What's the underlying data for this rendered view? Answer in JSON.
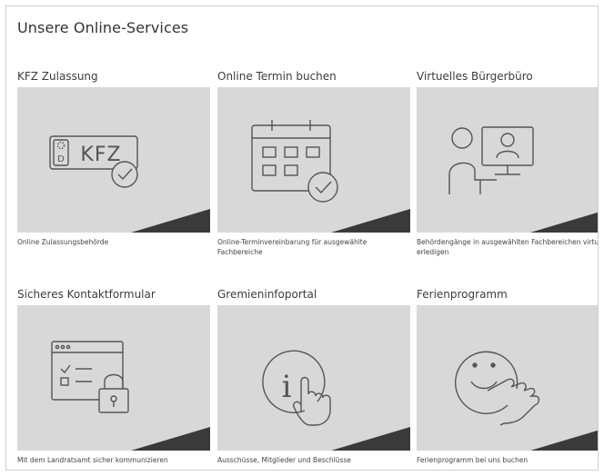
{
  "page": {
    "title": "Unsere Online-Services"
  },
  "cards": [
    {
      "title": "KFZ Zulassung",
      "description": "Online Zulassungsbehörde",
      "icon": "license-plate-check-icon",
      "plate_country": "D",
      "plate_text": "KFZ"
    },
    {
      "title": "Online Termin buchen",
      "description": "Online-Terminvereinbarung für ausgewählte Fachbereiche",
      "icon": "calendar-check-icon"
    },
    {
      "title": "Virtuelles Bürgerbüro",
      "description": "Behördengänge in ausgewählten Fachbereichen virtuell erledigen",
      "icon": "video-call-icon"
    },
    {
      "title": "Sicheres Kontaktformular",
      "description": "Mit dem Landratsamt sicher kommunizieren",
      "icon": "secure-form-lock-icon"
    },
    {
      "title": "Gremieninfoportal",
      "description": "Ausschüsse, Mitglieder und Beschlüsse",
      "icon": "info-touch-icon",
      "info_glyph": "i"
    },
    {
      "title": "Ferienprogramm",
      "description": "Ferienprogramm bei uns buchen",
      "icon": "smiley-touch-icon"
    }
  ],
  "colors": {
    "tile_background": "#d8d8d8",
    "corner_shade": "#3a3a3a",
    "icon_stroke": "#555555"
  }
}
